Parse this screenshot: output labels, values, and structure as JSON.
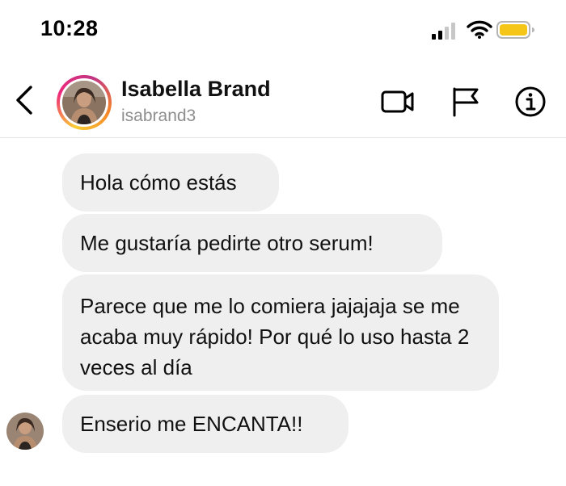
{
  "status_bar": {
    "time": "10:28",
    "icons": [
      "signal-icon",
      "wifi-icon",
      "battery-icon"
    ],
    "battery_color": "#f5c518"
  },
  "header": {
    "back_icon": "chevron-left-icon",
    "contact_name": "Isabella Brand",
    "contact_username": "isabrand3",
    "actions": [
      "video-call-icon",
      "flag-icon",
      "info-icon"
    ],
    "story_ring_colors": [
      "#f9ce34",
      "#ee2a7b",
      "#c13584"
    ]
  },
  "messages": [
    {
      "text": "Hola cómo estás"
    },
    {
      "text": "Me gustaría pedirte otro serum!"
    },
    {
      "text": "Parece que me lo comiera jajajaja se me acaba muy rápido! Por qué lo uso hasta 2 veces al día"
    },
    {
      "text": "Enserio me ENCANTA!!"
    }
  ],
  "colors": {
    "bubble_background": "#efefef",
    "secondary_text": "#8e8e8e"
  }
}
